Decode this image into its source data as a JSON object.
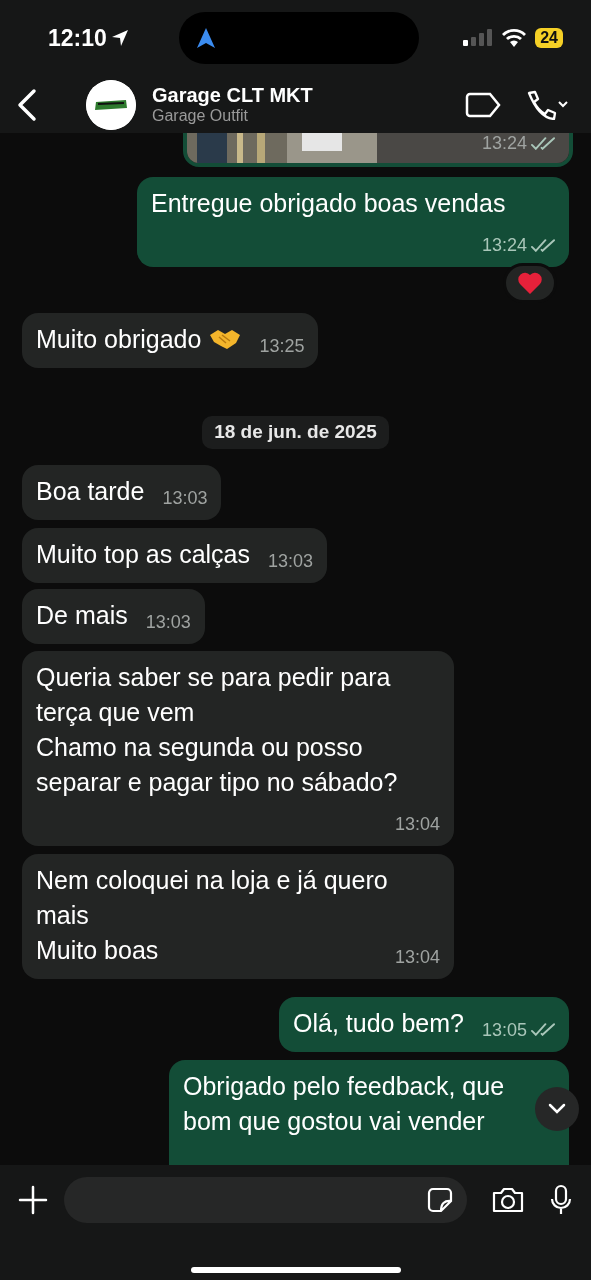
{
  "status_bar": {
    "time": "12:10",
    "battery": "24"
  },
  "header": {
    "title": "Garage CLT MKT",
    "subtitle": "Garage Outfit"
  },
  "messages": [
    {
      "outgoing": true,
      "time": "13:24",
      "read": false
    },
    {
      "kind": "text",
      "outgoing": true,
      "text": "Entregue obrigado boas vendas",
      "time": "13:24",
      "read": false,
      "reacted": true
    },
    {
      "kind": "text",
      "outgoing": false,
      "text": "Muito obrigado",
      "emoji": true,
      "time": "13:25"
    },
    {
      "kind": "date",
      "text": "18 de jun. de 2025"
    },
    {
      "kind": "text",
      "outgoing": false,
      "text": "Boa tarde",
      "time": "13:03"
    },
    {
      "kind": "text",
      "outgoing": false,
      "text": "Muito top as calças",
      "time": "13:03"
    },
    {
      "kind": "text",
      "outgoing": false,
      "text": "De mais",
      "time": "13:03"
    },
    {
      "kind": "text",
      "outgoing": false,
      "text": "Queria saber se para pedir para terça que vem\nChamo na segunda ou posso separar e pagar tipo no sábado?",
      "time": "13:04"
    },
    {
      "kind": "text",
      "outgoing": false,
      "text": "Nem coloquei na loja e já quero mais\nMuito boas",
      "time": "13:04"
    },
    {
      "kind": "text",
      "outgoing": true,
      "text": "Olá, tudo bem?",
      "time": "13:05",
      "read": false
    },
    {
      "kind": "text",
      "outgoing": true,
      "text": "Obrigado pelo feedback, que bom que gostou vai vender",
      "cut": true
    }
  ]
}
